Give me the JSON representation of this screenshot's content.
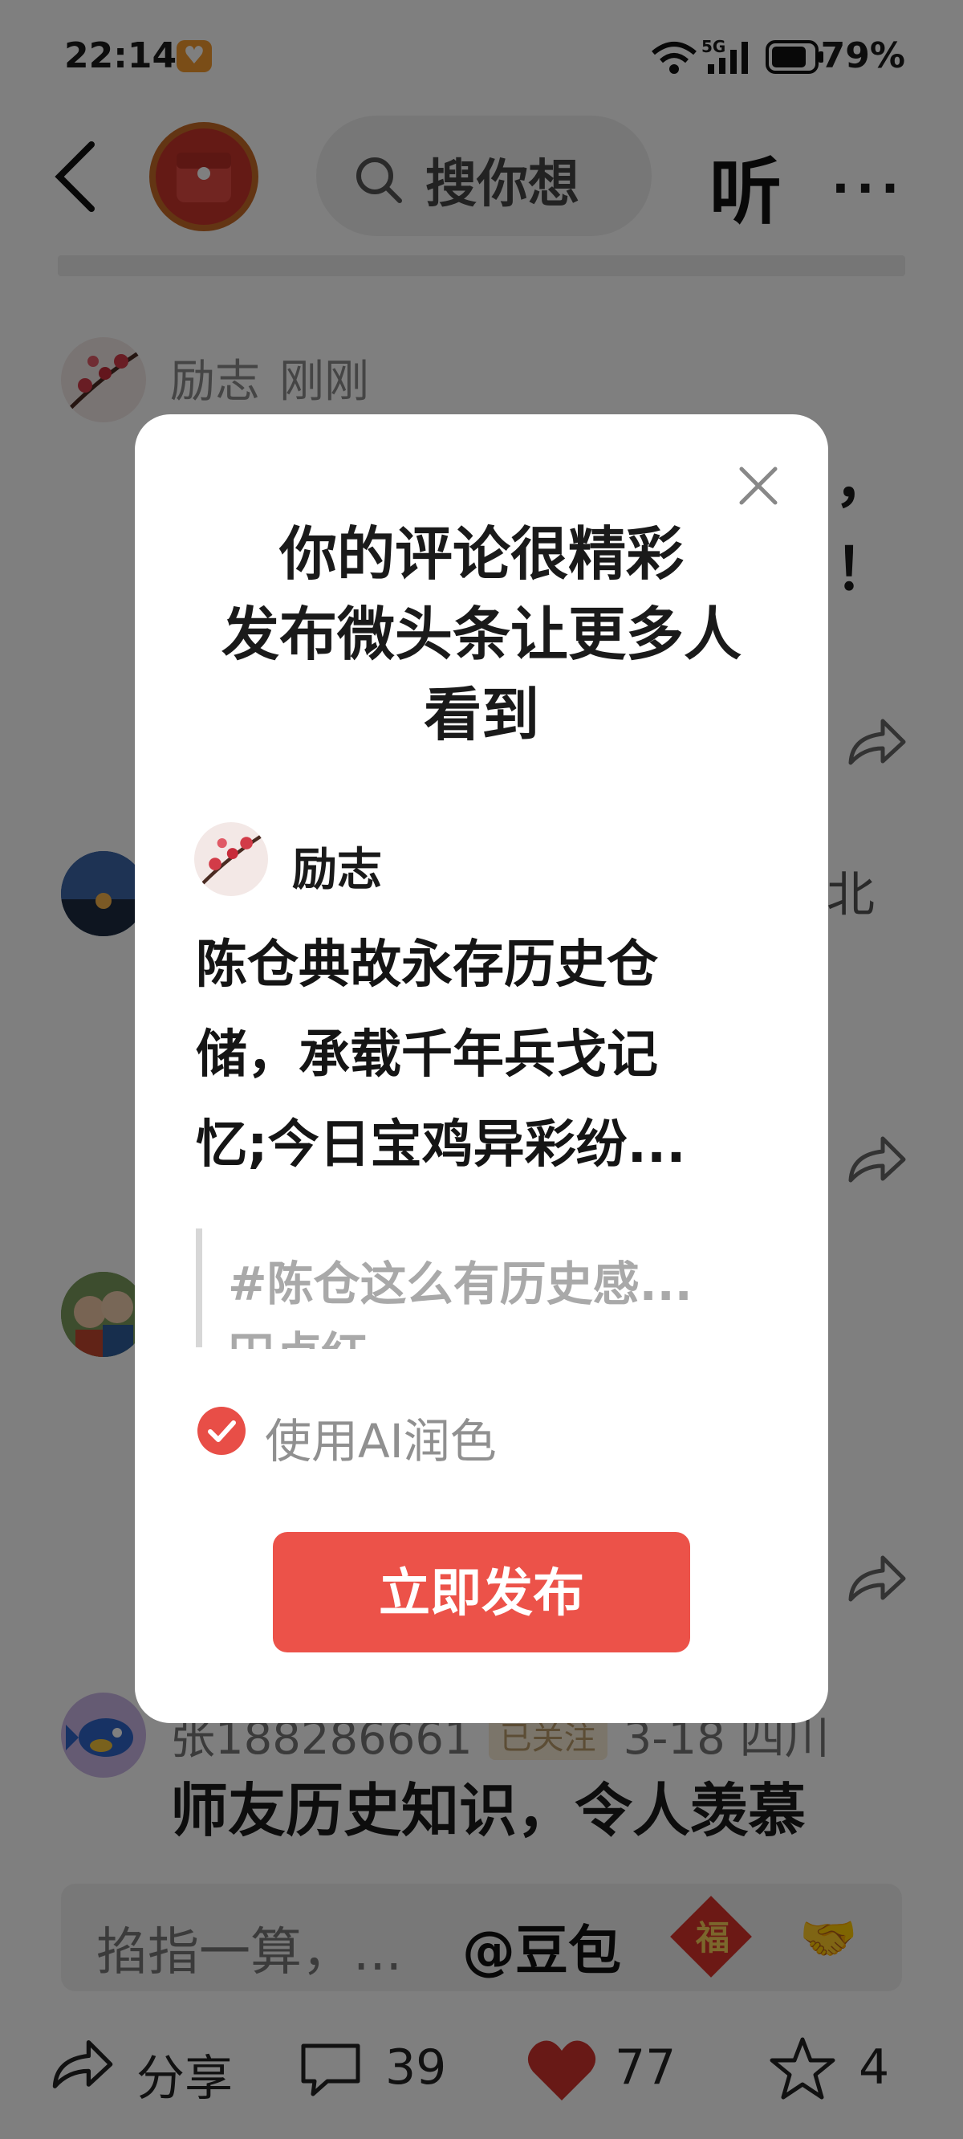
{
  "status_bar": {
    "time": "22:14",
    "network": "5G",
    "battery": "79%"
  },
  "top_nav": {
    "search_placeholder": "搜你想",
    "listen_label": "听",
    "more_label": "···"
  },
  "comments": [
    {
      "name": "励志",
      "meta": "刚刚",
      "body_tail_1": "，",
      "body_tail_2": "！"
    },
    {
      "name": "",
      "meta": "",
      "location_tail": "北"
    },
    {
      "name": "",
      "meta": ""
    },
    {
      "name": "张188286661",
      "badge": "已关注",
      "meta": "3-18 四川",
      "body": "师友历史知识，令人羡慕"
    }
  ],
  "input_bar": {
    "placeholder": "掐指一算，...",
    "mention": "@豆包",
    "fu": "福",
    "emoji": "🤝"
  },
  "action_bar": {
    "share_label": "分享",
    "comment_count": "39",
    "like_count": "77",
    "star_count": "4"
  },
  "modal": {
    "title_lines": [
      "你的评论很精彩",
      "发布微头条让更多人",
      "看到"
    ],
    "author": "励志",
    "body_lines": [
      "陈仓典故永存历史仓",
      "储，承载千年兵戈记",
      "忆;今日宝鸡异彩纷..."
    ],
    "quote_line_1": "#陈仓这么有历史感...",
    "quote_line_2": "田卢红",
    "ai_polish_label": "使用AI润色",
    "ai_polish_checked": true,
    "publish_label": "立即发布"
  },
  "colors": {
    "accent": "#ec5249",
    "overlay": "rgba(0,0,0,0.5)",
    "like": "#d0332d"
  }
}
